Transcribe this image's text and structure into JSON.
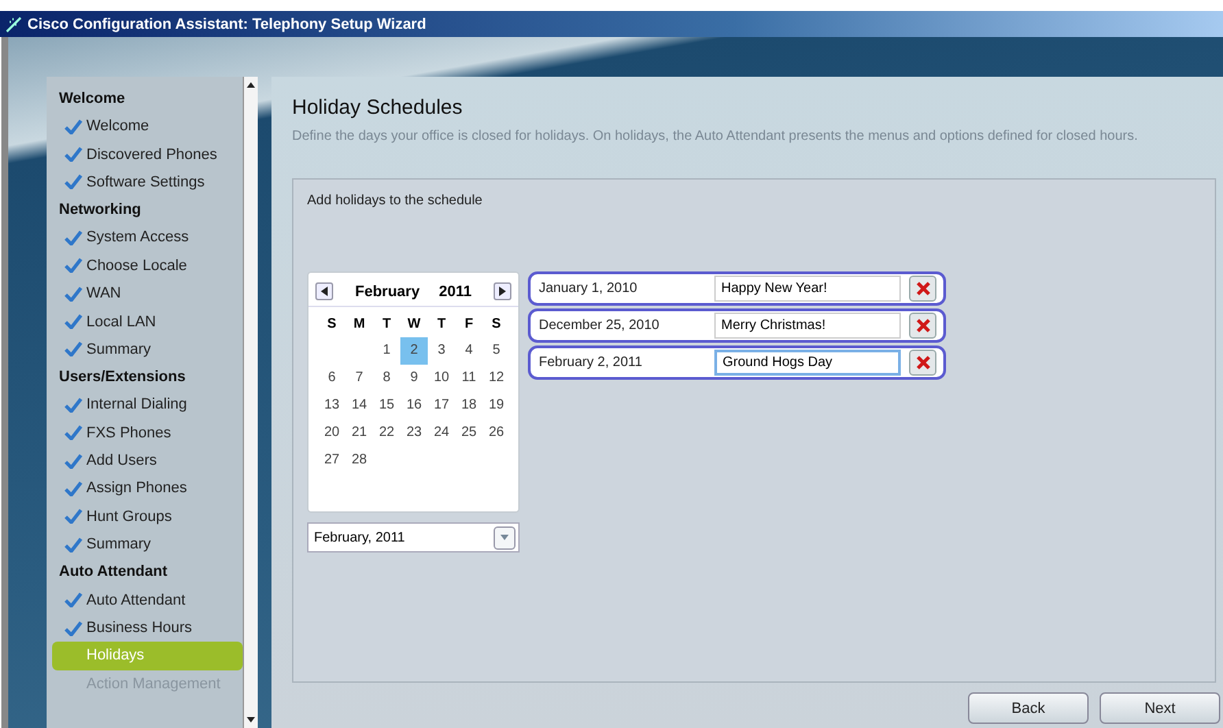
{
  "window": {
    "title": "Cisco Configuration Assistant: Telephony Setup Wizard"
  },
  "sidebar": {
    "sections": [
      {
        "title": "Welcome",
        "items": [
          {
            "label": "Welcome",
            "done": true,
            "selected": false,
            "disabled": false
          },
          {
            "label": "Discovered Phones",
            "done": true,
            "selected": false,
            "disabled": false
          },
          {
            "label": "Software Settings",
            "done": true,
            "selected": false,
            "disabled": false
          }
        ]
      },
      {
        "title": "Networking",
        "items": [
          {
            "label": "System Access",
            "done": true,
            "selected": false,
            "disabled": false
          },
          {
            "label": "Choose Locale",
            "done": true,
            "selected": false,
            "disabled": false
          },
          {
            "label": "WAN",
            "done": true,
            "selected": false,
            "disabled": false
          },
          {
            "label": "Local LAN",
            "done": true,
            "selected": false,
            "disabled": false
          },
          {
            "label": "Summary",
            "done": true,
            "selected": false,
            "disabled": false
          }
        ]
      },
      {
        "title": "Users/Extensions",
        "items": [
          {
            "label": "Internal Dialing",
            "done": true,
            "selected": false,
            "disabled": false
          },
          {
            "label": "FXS Phones",
            "done": true,
            "selected": false,
            "disabled": false
          },
          {
            "label": "Add Users",
            "done": true,
            "selected": false,
            "disabled": false
          },
          {
            "label": "Assign Phones",
            "done": true,
            "selected": false,
            "disabled": false
          },
          {
            "label": "Hunt Groups",
            "done": true,
            "selected": false,
            "disabled": false
          },
          {
            "label": "Summary",
            "done": true,
            "selected": false,
            "disabled": false
          }
        ]
      },
      {
        "title": "Auto Attendant",
        "items": [
          {
            "label": "Auto Attendant",
            "done": true,
            "selected": false,
            "disabled": false
          },
          {
            "label": "Business Hours",
            "done": true,
            "selected": false,
            "disabled": false
          },
          {
            "label": "Holidays",
            "done": false,
            "selected": true,
            "disabled": false
          },
          {
            "label": "Action Management",
            "done": false,
            "selected": false,
            "disabled": true
          }
        ]
      }
    ]
  },
  "page": {
    "title": "Holiday Schedules",
    "description": "Define the days your office is closed for holidays. On holidays, the Auto Attendant presents the menus and options defined for closed hours.",
    "instruction": "Add holidays to the schedule"
  },
  "calendar": {
    "month": "February",
    "year": "2011",
    "weekdays": [
      "S",
      "M",
      "T",
      "W",
      "T",
      "F",
      "S"
    ],
    "days": [
      {
        "kind": "blank"
      },
      {
        "kind": "blank"
      },
      {
        "kind": "day",
        "label": "1",
        "selected": false
      },
      {
        "kind": "day",
        "label": "2",
        "selected": true
      },
      {
        "kind": "day",
        "label": "3",
        "selected": false
      },
      {
        "kind": "day",
        "label": "4",
        "selected": false
      },
      {
        "kind": "day",
        "label": "5",
        "selected": false
      },
      {
        "kind": "day",
        "label": "6",
        "selected": false
      },
      {
        "kind": "day",
        "label": "7",
        "selected": false
      },
      {
        "kind": "day",
        "label": "8",
        "selected": false
      },
      {
        "kind": "day",
        "label": "9",
        "selected": false
      },
      {
        "kind": "day",
        "label": "10",
        "selected": false
      },
      {
        "kind": "day",
        "label": "11",
        "selected": false
      },
      {
        "kind": "day",
        "label": "12",
        "selected": false
      },
      {
        "kind": "day",
        "label": "13",
        "selected": false
      },
      {
        "kind": "day",
        "label": "14",
        "selected": false
      },
      {
        "kind": "day",
        "label": "15",
        "selected": false
      },
      {
        "kind": "day",
        "label": "16",
        "selected": false
      },
      {
        "kind": "day",
        "label": "17",
        "selected": false
      },
      {
        "kind": "day",
        "label": "18",
        "selected": false
      },
      {
        "kind": "day",
        "label": "19",
        "selected": false
      },
      {
        "kind": "day",
        "label": "20",
        "selected": false
      },
      {
        "kind": "day",
        "label": "21",
        "selected": false
      },
      {
        "kind": "day",
        "label": "22",
        "selected": false
      },
      {
        "kind": "day",
        "label": "23",
        "selected": false
      },
      {
        "kind": "day",
        "label": "24",
        "selected": false
      },
      {
        "kind": "day",
        "label": "25",
        "selected": false
      },
      {
        "kind": "day",
        "label": "26",
        "selected": false
      },
      {
        "kind": "day",
        "label": "27",
        "selected": false
      },
      {
        "kind": "day",
        "label": "28",
        "selected": false
      }
    ],
    "month_select": "February, 2011"
  },
  "holidays": [
    {
      "date": "January 1, 2010",
      "name": "Happy New Year!",
      "focused": false
    },
    {
      "date": "December 25, 2010",
      "name": "Merry Christmas!",
      "focused": false
    },
    {
      "date": "February 2, 2011",
      "name": "Ground Hogs Day",
      "focused": true
    }
  ],
  "buttons": [
    "Back",
    "Next"
  ]
}
